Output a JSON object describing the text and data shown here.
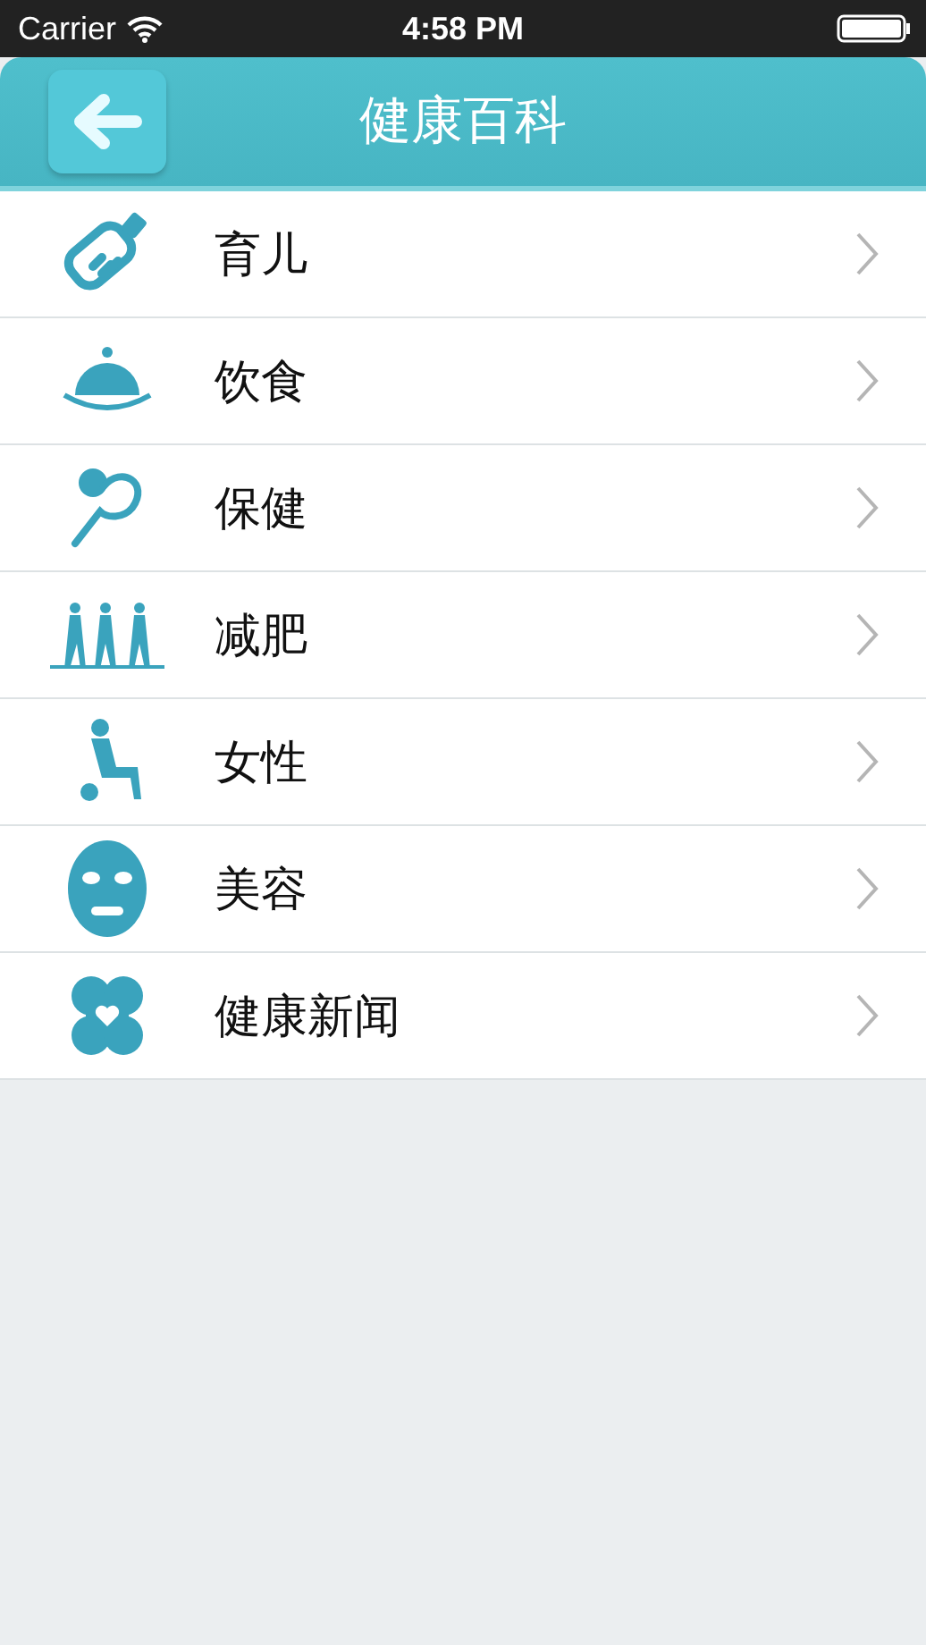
{
  "status_bar": {
    "carrier": "Carrier",
    "time": "4:58 PM"
  },
  "nav_bar": {
    "title": "健康百科"
  },
  "items": [
    {
      "label": "育儿"
    },
    {
      "label": "饮食"
    },
    {
      "label": "保健"
    },
    {
      "label": "减肥"
    },
    {
      "label": "女性"
    },
    {
      "label": "美容"
    },
    {
      "label": "健康新闻"
    }
  ]
}
